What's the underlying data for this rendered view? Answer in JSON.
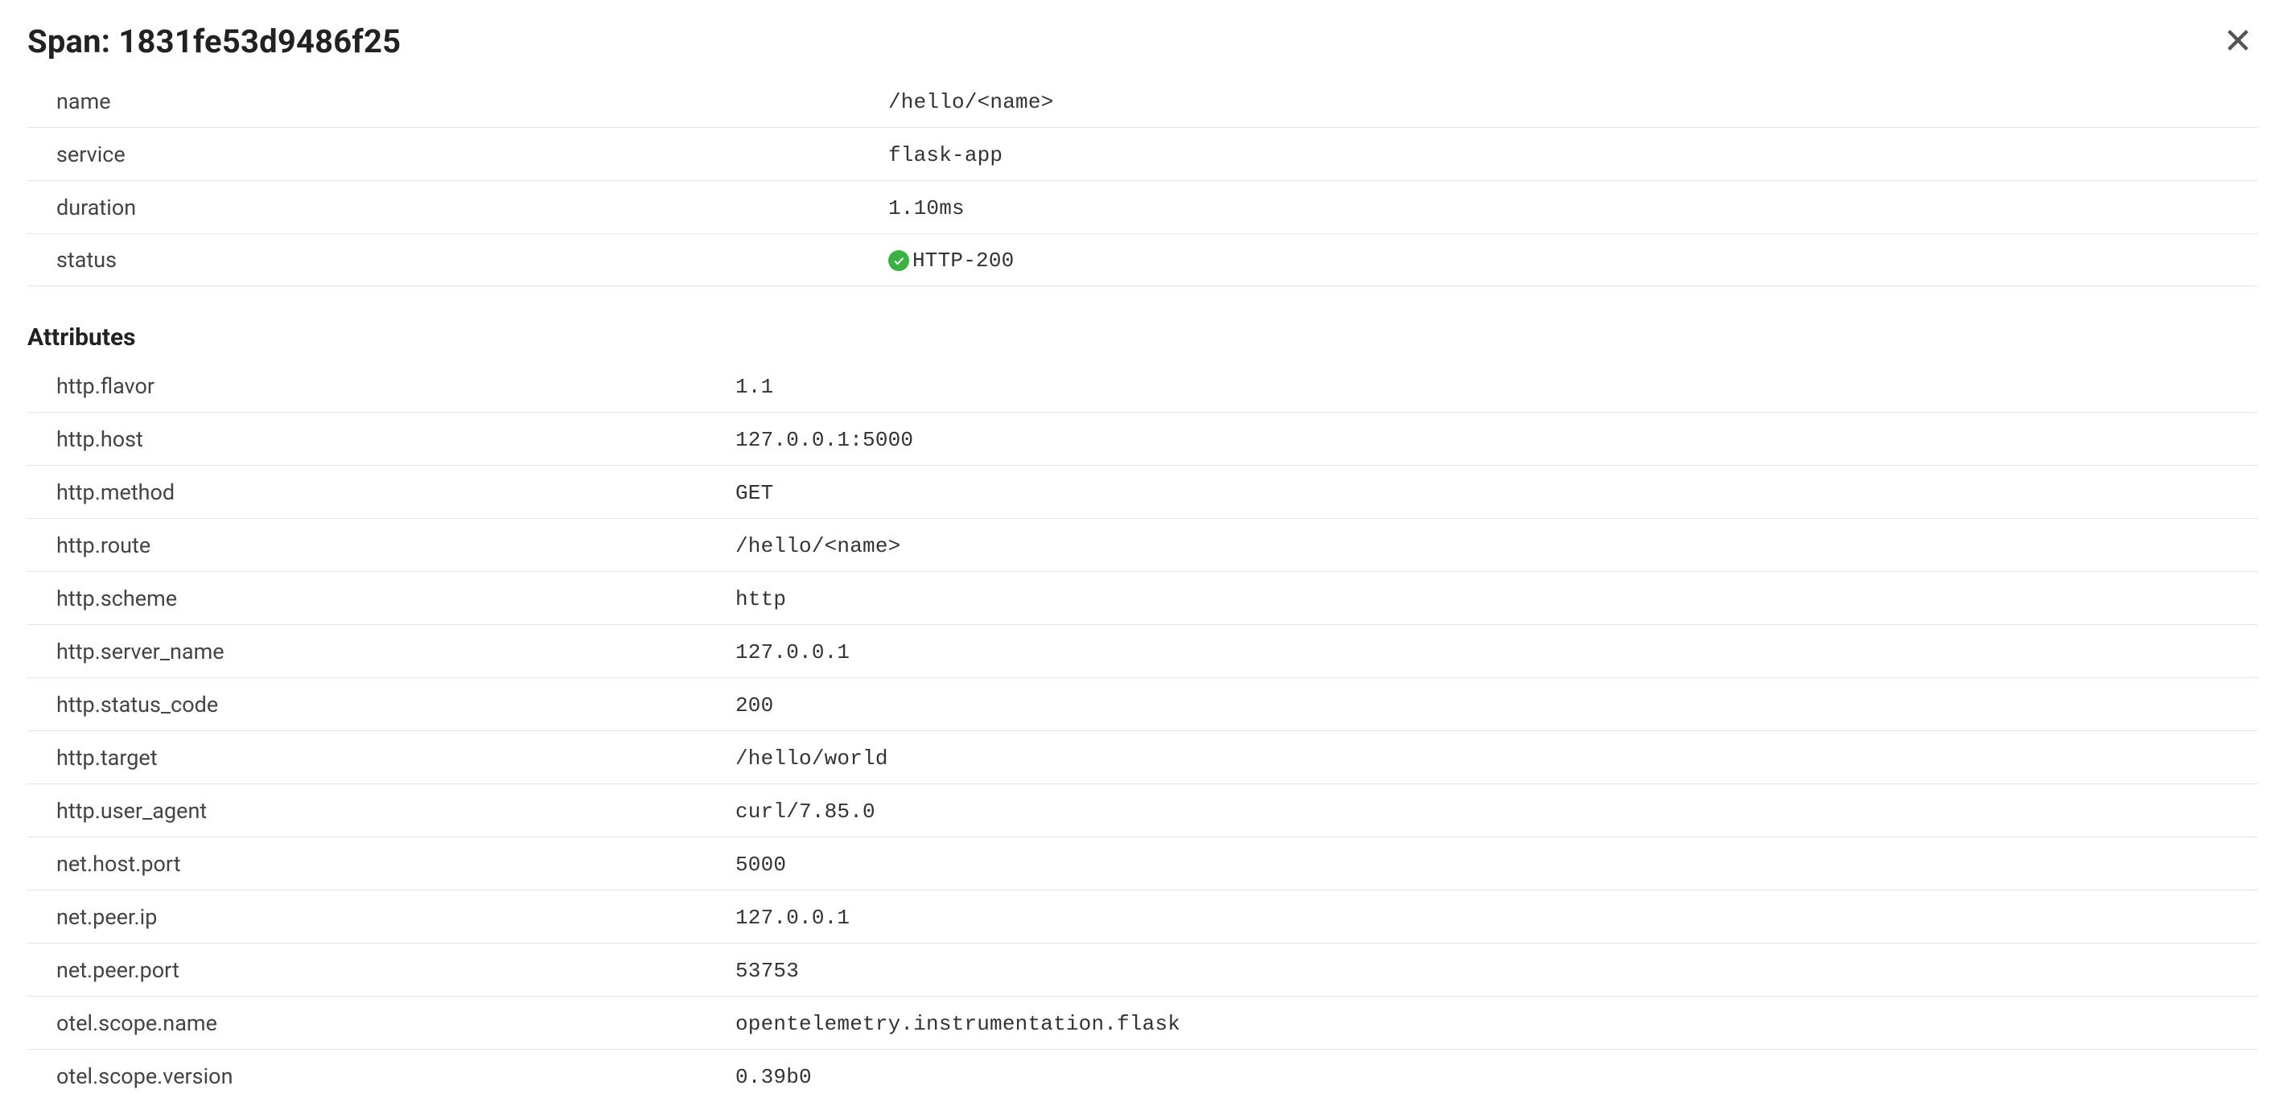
{
  "header": {
    "title_prefix": "Span: ",
    "span_id": "1831fe53d9486f25"
  },
  "meta": [
    {
      "key": "name",
      "value": "/hello/<name>",
      "mono": true
    },
    {
      "key": "service",
      "value": "flask-app",
      "mono": true
    },
    {
      "key": "duration",
      "value": "1.10ms",
      "mono": true
    },
    {
      "key": "status",
      "value": "HTTP-200",
      "mono": true,
      "status_ok": true
    }
  ],
  "attributes_title": "Attributes",
  "attributes": [
    {
      "key": "http.flavor",
      "value": "1.1"
    },
    {
      "key": "http.host",
      "value": "127.0.0.1:5000"
    },
    {
      "key": "http.method",
      "value": "GET"
    },
    {
      "key": "http.route",
      "value": "/hello/<name>"
    },
    {
      "key": "http.scheme",
      "value": "http"
    },
    {
      "key": "http.server_name",
      "value": "127.0.0.1"
    },
    {
      "key": "http.status_code",
      "value": "200"
    },
    {
      "key": "http.target",
      "value": "/hello/world"
    },
    {
      "key": "http.user_agent",
      "value": "curl/7.85.0"
    },
    {
      "key": "net.host.port",
      "value": "5000"
    },
    {
      "key": "net.peer.ip",
      "value": "127.0.0.1"
    },
    {
      "key": "net.peer.port",
      "value": "53753"
    },
    {
      "key": "otel.scope.name",
      "value": "opentelemetry.instrumentation.flask"
    },
    {
      "key": "otel.scope.version",
      "value": "0.39b0"
    }
  ]
}
